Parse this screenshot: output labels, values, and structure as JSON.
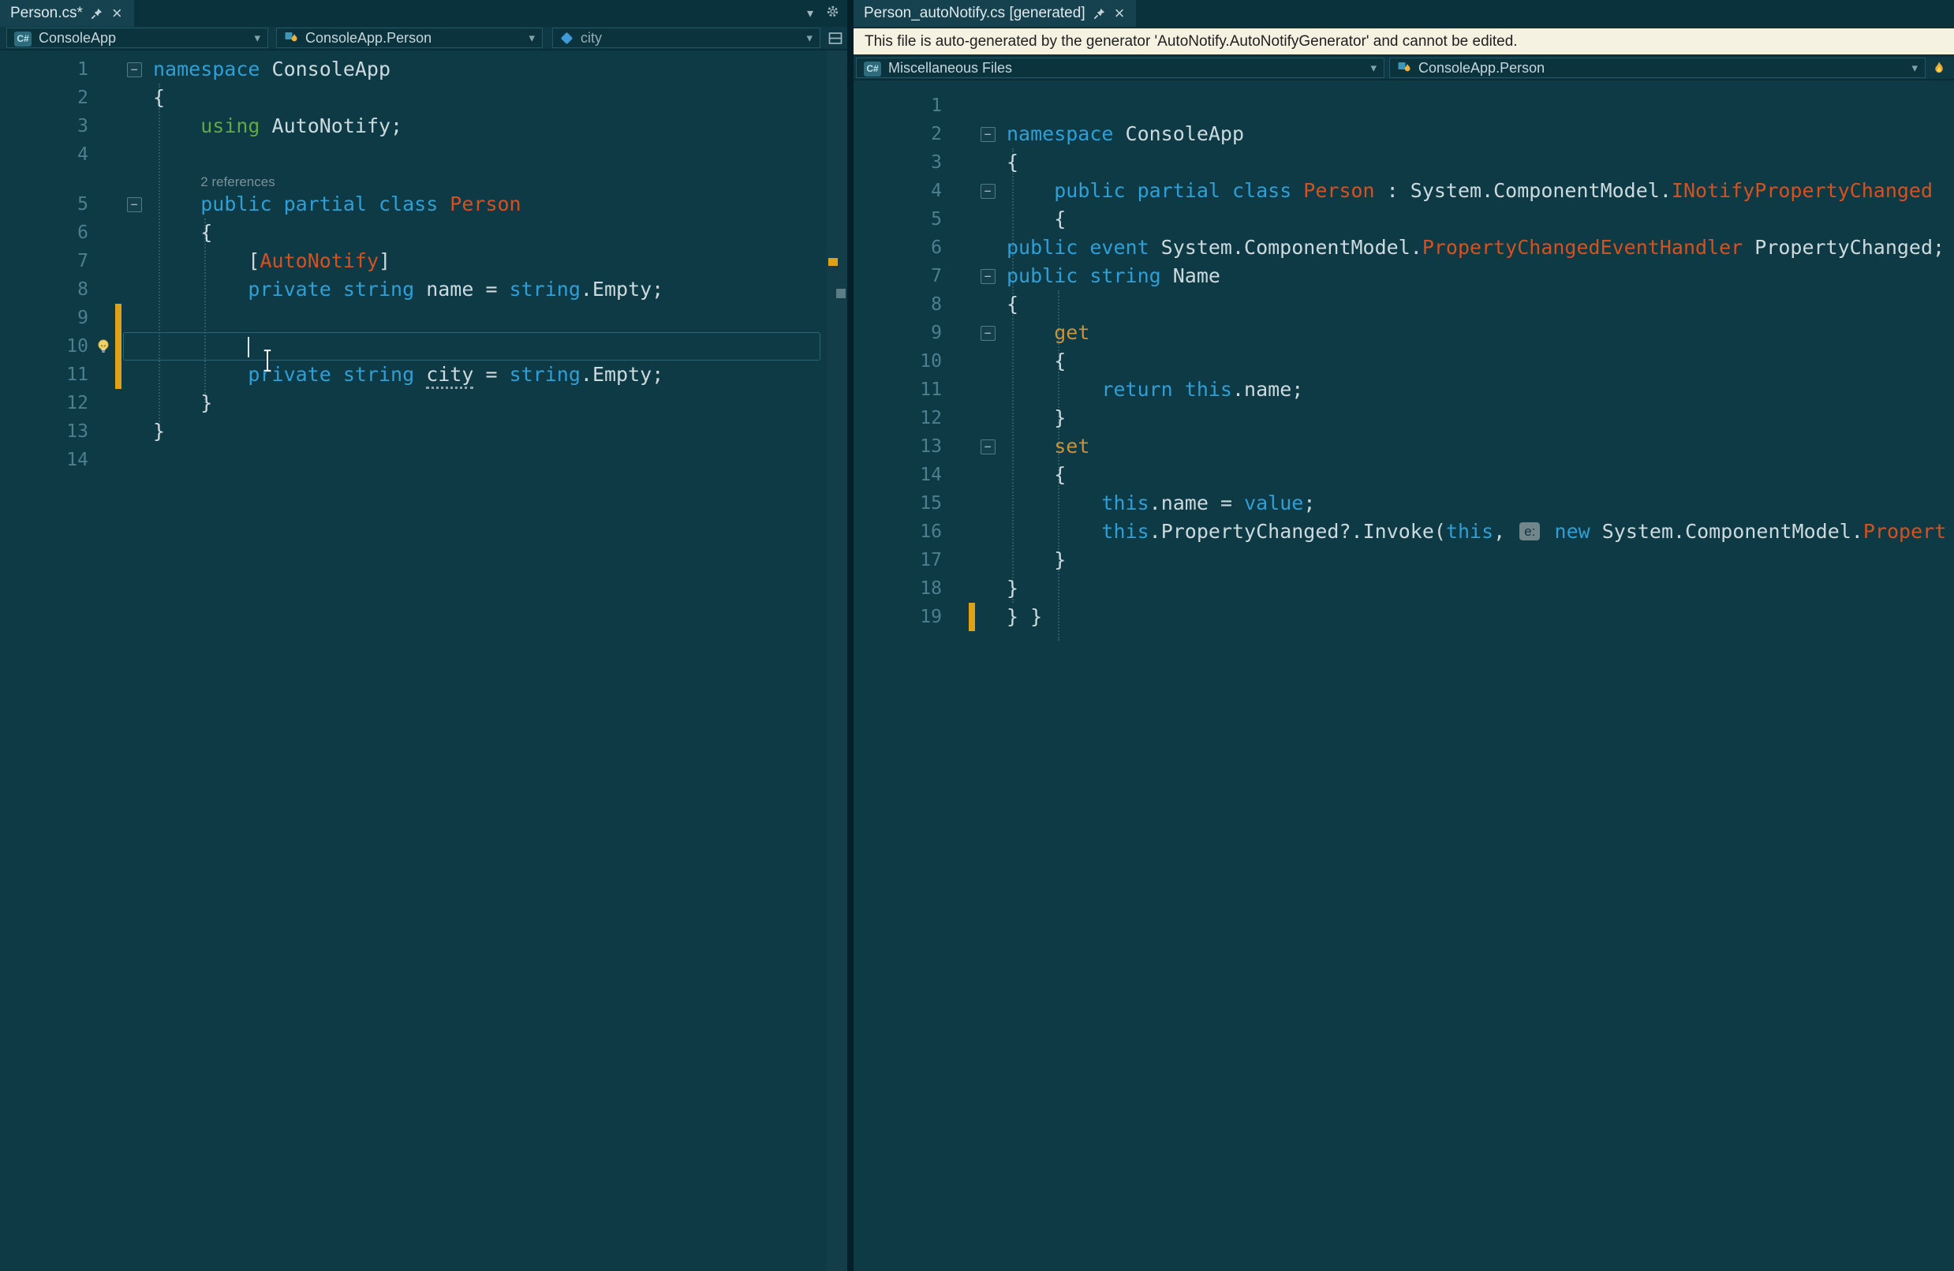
{
  "colors": {
    "editor_bg": "#0e3a46",
    "chrome_bg": "#0a323d",
    "tab_active_bg": "#16424f",
    "navbar_bg": "#0d3844",
    "keyword": "#2f9fd6",
    "type": "#d7511f",
    "string_green": "#63a845",
    "accessor": "#c9913c",
    "plain": "#ccdade",
    "line_number": "#4e7f8e",
    "codelens": "#7b9199",
    "infobar_bg": "#f5f2e2",
    "infobar_text": "#1f1f1f",
    "change_bar": "#dfa117",
    "guide": "#2c5a66",
    "selection_border": "#2e6375",
    "badge_bg": "#72858b",
    "badge_text": "#0e3540"
  },
  "icons": {
    "fold_glyph": "−",
    "dropdown_arrow": "▾",
    "close_glyph": "×",
    "csharp_glyph": "C#"
  },
  "left_pane": {
    "tab_title": "Person.cs*",
    "navbar": {
      "project": "ConsoleApp",
      "type": "ConsoleApp.Person",
      "member": "city"
    },
    "codelens_text": "2 references",
    "lines": [
      {
        "num": 1,
        "fold": true,
        "indent": 0,
        "tokens": [
          [
            "kw",
            "namespace"
          ],
          [
            "pl",
            " ConsoleApp"
          ]
        ]
      },
      {
        "num": 2,
        "indent": 0,
        "tokens": [
          [
            "pl",
            "{"
          ]
        ]
      },
      {
        "num": 3,
        "indent": 4,
        "tokens": [
          [
            "grn",
            "using"
          ],
          [
            "pl",
            " AutoNotify;"
          ]
        ]
      },
      {
        "num": 4,
        "indent": 0,
        "tokens": []
      },
      {
        "lens": true,
        "indent": 4,
        "tokens": [
          [
            "lens",
            "2 references"
          ]
        ]
      },
      {
        "num": 5,
        "fold": true,
        "indent": 4,
        "tokens": [
          [
            "kw",
            "public partial class "
          ],
          [
            "ty",
            "Person"
          ]
        ]
      },
      {
        "num": 6,
        "indent": 4,
        "tokens": [
          [
            "pl",
            "{"
          ]
        ]
      },
      {
        "num": 7,
        "indent": 8,
        "tokens": [
          [
            "pl",
            "["
          ],
          [
            "ty",
            "AutoNotify"
          ],
          [
            "pl",
            "]"
          ]
        ]
      },
      {
        "num": 8,
        "indent": 8,
        "tokens": [
          [
            "kw",
            "private string "
          ],
          [
            "pl",
            "name = "
          ],
          [
            "kw",
            "string"
          ],
          [
            "pl",
            ".Empty;"
          ]
        ]
      },
      {
        "num": 9,
        "indent": 0,
        "changed": true,
        "tokens": []
      },
      {
        "num": 10,
        "indent": 8,
        "changed": true,
        "current": true,
        "bulb": true,
        "caret": true,
        "tokens": []
      },
      {
        "num": 11,
        "indent": 8,
        "changed": true,
        "tokens": [
          [
            "kw",
            "private string "
          ],
          [
            "warn",
            "city"
          ],
          [
            "pl",
            " = "
          ],
          [
            "kw",
            "string"
          ],
          [
            "pl",
            ".Empty;"
          ]
        ]
      },
      {
        "num": 12,
        "indent": 4,
        "tokens": [
          [
            "pl",
            "}"
          ]
        ]
      },
      {
        "num": 13,
        "indent": 0,
        "tokens": [
          [
            "pl",
            "}"
          ]
        ]
      },
      {
        "num": 14,
        "indent": 0,
        "tokens": []
      }
    ]
  },
  "right_pane": {
    "tab_title": "Person_autoNotify.cs [generated]",
    "infobar_text": "This file is auto-generated by the generator 'AutoNotify.AutoNotifyGenerator' and cannot be edited.",
    "navbar": {
      "project": "Miscellaneous Files",
      "type": "ConsoleApp.Person"
    },
    "lines": [
      {
        "num": 1,
        "indent": 0,
        "tokens": []
      },
      {
        "num": 2,
        "fold": true,
        "indent": 0,
        "tokens": [
          [
            "kw",
            "namespace"
          ],
          [
            "pl",
            " ConsoleApp"
          ]
        ]
      },
      {
        "num": 3,
        "indent": 0,
        "tokens": [
          [
            "pl",
            "{"
          ]
        ]
      },
      {
        "num": 4,
        "fold": true,
        "indent": 4,
        "tokens": [
          [
            "kw",
            "public partial class "
          ],
          [
            "ty",
            "Person"
          ],
          [
            "pl",
            " : System.ComponentModel."
          ],
          [
            "ty",
            "INotifyPropertyChanged"
          ]
        ]
      },
      {
        "num": 5,
        "indent": 4,
        "tokens": [
          [
            "pl",
            "{"
          ]
        ]
      },
      {
        "num": 6,
        "indent": 0,
        "tokens": [
          [
            "kw",
            "public event "
          ],
          [
            "pl",
            "System.ComponentModel."
          ],
          [
            "ty",
            "PropertyChangedEventHandler"
          ],
          [
            "pl",
            " PropertyChanged;"
          ]
        ]
      },
      {
        "num": 7,
        "fold": true,
        "indent": 0,
        "tokens": [
          [
            "kw",
            "public string "
          ],
          [
            "pl",
            "Name"
          ]
        ]
      },
      {
        "num": 8,
        "indent": 0,
        "tokens": [
          [
            "pl",
            "{"
          ]
        ]
      },
      {
        "num": 9,
        "fold": true,
        "indent": 4,
        "tokens": [
          [
            "kw2",
            "get"
          ]
        ]
      },
      {
        "num": 10,
        "indent": 4,
        "tokens": [
          [
            "pl",
            "{"
          ]
        ]
      },
      {
        "num": 11,
        "indent": 8,
        "tokens": [
          [
            "kw",
            "return this"
          ],
          [
            "pl",
            ".name;"
          ]
        ]
      },
      {
        "num": 12,
        "indent": 4,
        "tokens": [
          [
            "pl",
            "}"
          ]
        ]
      },
      {
        "num": 13,
        "fold": true,
        "indent": 4,
        "tokens": [
          [
            "kw2",
            "set"
          ]
        ]
      },
      {
        "num": 14,
        "indent": 4,
        "tokens": [
          [
            "pl",
            "{"
          ]
        ]
      },
      {
        "num": 15,
        "indent": 8,
        "tokens": [
          [
            "kw",
            "this"
          ],
          [
            "pl",
            ".name = "
          ],
          [
            "kw",
            "value"
          ],
          [
            "pl",
            ";"
          ]
        ]
      },
      {
        "num": 16,
        "indent": 8,
        "tokens": [
          [
            "kw",
            "this"
          ],
          [
            "pl",
            ".PropertyChanged?.Invoke("
          ],
          [
            "kw",
            "this"
          ],
          [
            "pl",
            ", "
          ],
          [
            "badge",
            "e:"
          ],
          [
            "pl",
            " "
          ],
          [
            "kw",
            "new"
          ],
          [
            "pl",
            " System.ComponentModel."
          ],
          [
            "ty",
            "Propert"
          ]
        ]
      },
      {
        "num": 17,
        "indent": 4,
        "tokens": [
          [
            "pl",
            "}"
          ]
        ]
      },
      {
        "num": 18,
        "indent": 0,
        "tokens": [
          [
            "pl",
            "}"
          ]
        ]
      },
      {
        "num": 19,
        "indent": 0,
        "changed": true,
        "tokens": [
          [
            "pl",
            "} }"
          ]
        ]
      }
    ]
  }
}
